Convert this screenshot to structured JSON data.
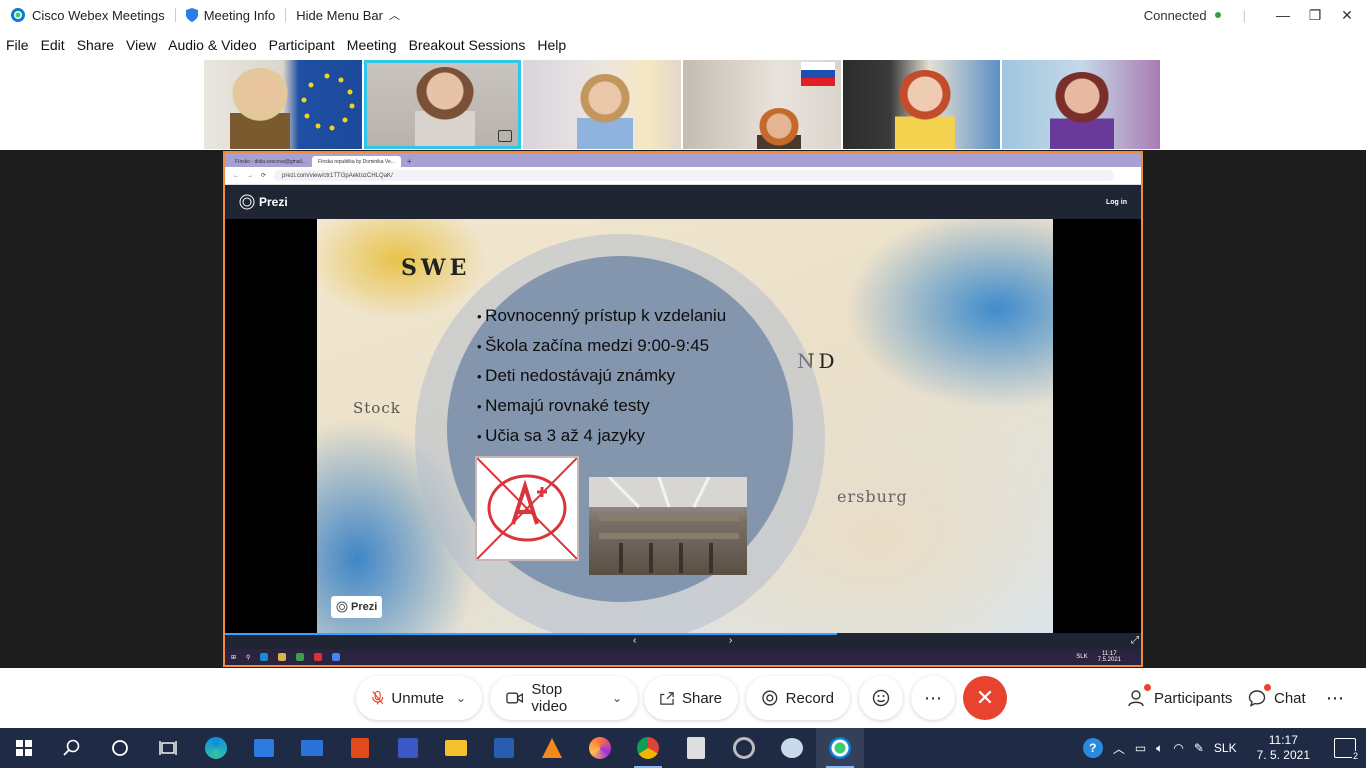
{
  "titlebar": {
    "app_name": "Cisco Webex Meetings",
    "meeting_info": "Meeting Info",
    "hide_menu": "Hide Menu Bar",
    "status": "Connected"
  },
  "menu": [
    "File",
    "Edit",
    "Share",
    "View",
    "Audio & Video",
    "Participant",
    "Meeting",
    "Breakout Sessions",
    "Help"
  ],
  "browser": {
    "tabs": [
      "Fínsko - didia.svecova@gmail...",
      "Fínska republika by Dominika Ve..."
    ],
    "url": "prezi.com/view/ctr1TTGpAektozCHLQaK/"
  },
  "prezi": {
    "logo": "Prezi",
    "login": "Log in",
    "watermark": "Prezi"
  },
  "slide": {
    "bullets": [
      "Rovnocenný prístup k vzdelaniu",
      "Škola začína medzi 9:00-9:45",
      "Deti nedostávajú známky",
      "Nemajú rovnaké testy",
      "Učia sa 3 až 4 jazyky"
    ],
    "map_labels": [
      "SWE",
      "Stock",
      "ND",
      "ersburg"
    ]
  },
  "inner_taskbar": {
    "lang": "SLK",
    "time": "11:17",
    "date": "7.5.2021"
  },
  "controls": {
    "unmute": "Unmute",
    "stop_video": "Stop video",
    "share": "Share",
    "record": "Record",
    "participants": "Participants",
    "chat": "Chat"
  },
  "taskbar": {
    "lang": "SLK",
    "time": "11:17",
    "date": "7. 5. 2021",
    "notifications": "2"
  },
  "colors": {
    "active_speaker": "#2fc6e8",
    "share_border": "#f08a3c",
    "end_call": "#e8432e",
    "connected": "#2ea043"
  }
}
